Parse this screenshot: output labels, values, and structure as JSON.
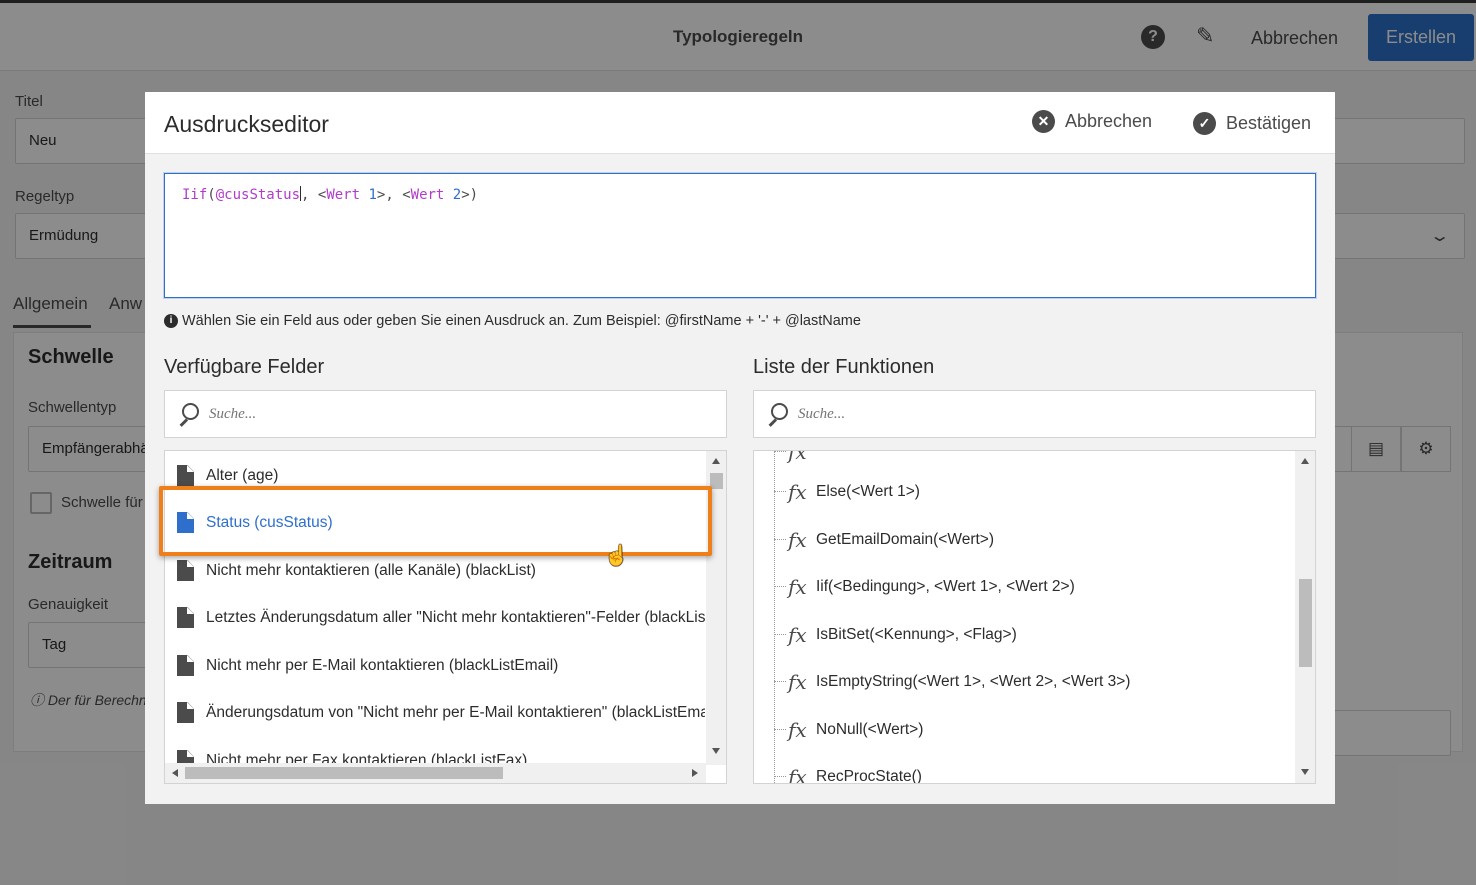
{
  "app": {
    "title": "Typologieregeln",
    "help_icon": "help-icon",
    "edit_icon": "pencil-icon",
    "cancel_label": "Abbrechen",
    "create_label": "Erstellen",
    "accent_color": "#2d6fcb"
  },
  "form": {
    "title_label": "Titel",
    "title_value": "Neu",
    "ruletype_label": "Regeltyp",
    "ruletype_value": "Ermüdung",
    "tabs": [
      {
        "label": "Allgemein"
      },
      {
        "label": "Anw"
      }
    ],
    "threshold_section": "Schwelle",
    "threshold_type_label": "Schwellentyp",
    "threshold_type_value": "Empfängerabhä",
    "threshold_checkbox_label": "Schwelle für",
    "period_section": "Zeitraum",
    "precision_label": "Genauigkeit",
    "precision_value": "Tag",
    "note_text": "Der für Berechn"
  },
  "modal": {
    "title": "Ausdruckseditor",
    "cancel_label": "Abbrechen",
    "confirm_label": "Bestätigen",
    "expression": {
      "fn": "Iif",
      "open": "(",
      "field": "@cusStatus",
      "sep1": ", <",
      "kw1": "Wert",
      "num1": "1",
      "sep2": ">, <",
      "kw2": "Wert",
      "num2": "2",
      "close": ">)"
    },
    "hint": "Wählen Sie ein Feld aus oder geben Sie einen Ausdruck an. Zum Beispiel: @firstName + '-' + @lastName",
    "fields": {
      "title": "Verfügbare Felder",
      "search_placeholder": "Suche...",
      "items": [
        {
          "label": "Alter (age)"
        },
        {
          "label": "Status (cusStatus)"
        },
        {
          "label": "Nicht mehr kontaktieren (alle Kanäle) (blackList)"
        },
        {
          "label": "Letztes Änderungsdatum aller \"Nicht mehr kontaktieren\"-Felder (blackListAl"
        },
        {
          "label": "Nicht mehr per E-Mail kontaktieren (blackListEmail)"
        },
        {
          "label": "Änderungsdatum von \"Nicht mehr per E-Mail kontaktieren\" (blackListEmailL"
        },
        {
          "label": "Nicht mehr per Fax kontaktieren (blackListFax)"
        }
      ],
      "selected_index": 1
    },
    "functions": {
      "title": "Liste der Funktionen",
      "search_placeholder": "Suche...",
      "items": [
        {
          "label": "Else(<Wert 1>)"
        },
        {
          "label": "GetEmailDomain(<Wert>)"
        },
        {
          "label": "Iif(<Bedingung>, <Wert 1>, <Wert 2>)"
        },
        {
          "label": "IsBitSet(<Kennung>, <Flag>)"
        },
        {
          "label": "IsEmptyString(<Wert 1>, <Wert 2>, <Wert 3>)"
        },
        {
          "label": "NoNull(<Wert>)"
        },
        {
          "label": "RecProcState()"
        }
      ]
    }
  }
}
